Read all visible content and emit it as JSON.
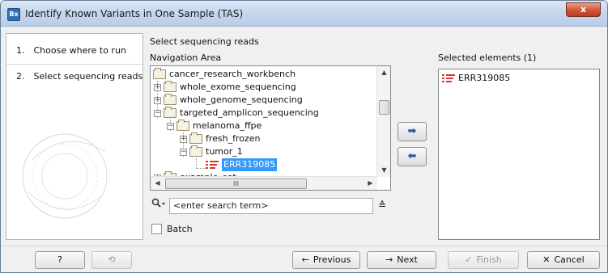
{
  "window": {
    "title": "Identify Known Variants in One Sample (TAS)",
    "app_icon_text": "Bx",
    "close_label": "x"
  },
  "steps": [
    {
      "number": "1.",
      "label": "Choose where to run"
    },
    {
      "number": "2.",
      "label": "Select sequencing reads"
    }
  ],
  "content": {
    "title": "Select sequencing reads",
    "navigation_label": "Navigation Area",
    "selected_label": "Selected elements (1)"
  },
  "tree": [
    {
      "label": "cancer_research_workbench",
      "type": "folder-open"
    },
    {
      "label": "whole_exome_sequencing",
      "type": "folder"
    },
    {
      "label": "whole_genome_sequencing",
      "type": "folder"
    },
    {
      "label": "targeted_amplicon_sequencing",
      "type": "folder-open"
    },
    {
      "label": "melanoma_ffpe",
      "type": "folder-open"
    },
    {
      "label": "fresh_frozen",
      "type": "folder"
    },
    {
      "label": "tumor_1",
      "type": "folder-open"
    },
    {
      "label": "ERR319085",
      "type": "sequence",
      "selected": true
    },
    {
      "label": "example_set",
      "type": "folder"
    }
  ],
  "hscroll_glyph": "III",
  "search": {
    "placeholder": "<enter search term>",
    "value": "<enter search term>"
  },
  "selected_elements": [
    {
      "label": "ERR319085"
    }
  ],
  "batch_label": "Batch",
  "buttons": {
    "help": "?",
    "reset": "⟲",
    "previous": "Previous",
    "next": "Next",
    "finish": "Finish",
    "cancel": "Cancel",
    "move_right": "➡",
    "move_left": "⬅"
  },
  "colors": {
    "selection": "#3399ff",
    "sequence_icon": "#d23b2b",
    "arrow_blue": "#1f5fa8"
  }
}
